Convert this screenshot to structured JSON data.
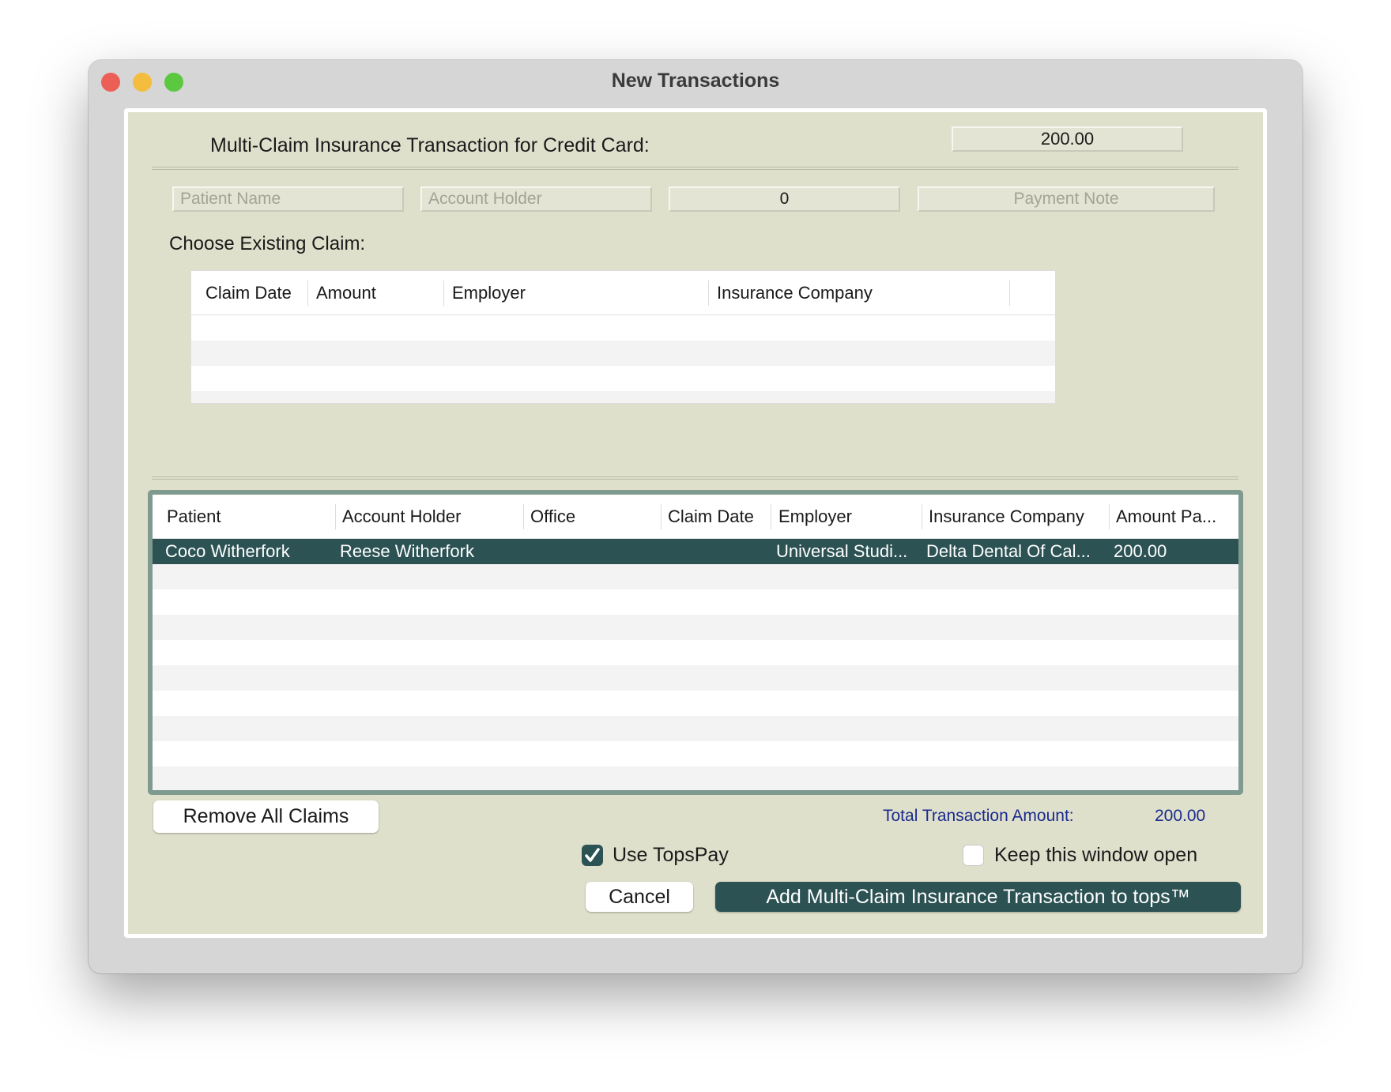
{
  "window": {
    "title": "New Transactions"
  },
  "header": {
    "label": "Multi-Claim Insurance Transaction for Credit Card:",
    "amount": "200.00"
  },
  "fields": {
    "patient_name_placeholder": "Patient Name",
    "account_holder_placeholder": "Account Holder",
    "amount_value": "0",
    "payment_note_placeholder": "Payment Note"
  },
  "existing_claims": {
    "label": "Choose Existing Claim:",
    "columns": [
      "Claim Date",
      "Amount",
      "Employer",
      "Insurance Company"
    ]
  },
  "claims": {
    "columns": [
      "Patient",
      "Account Holder",
      "Office",
      "Claim Date",
      "Employer",
      "Insurance Company",
      "Amount Pa..."
    ],
    "rows": [
      {
        "patient": "Coco Witherfork",
        "account_holder": "Reese Witherfork",
        "office": "",
        "claim_date": "",
        "employer": "Universal Studi...",
        "insurance_company": "Delta Dental Of Cal...",
        "amount": "200.00"
      }
    ]
  },
  "footer": {
    "remove_all": "Remove All Claims",
    "total_label": "Total Transaction Amount:",
    "total_value": "200.00",
    "use_topspay": "Use TopsPay",
    "use_topspay_checked": true,
    "keep_open": "Keep this window open",
    "keep_open_checked": false,
    "cancel": "Cancel",
    "submit": "Add Multi-Claim Insurance Transaction to tops™"
  },
  "colors": {
    "accent": "#2c5254",
    "panel": "#dfe0cc",
    "total": "#1a2a8c"
  }
}
